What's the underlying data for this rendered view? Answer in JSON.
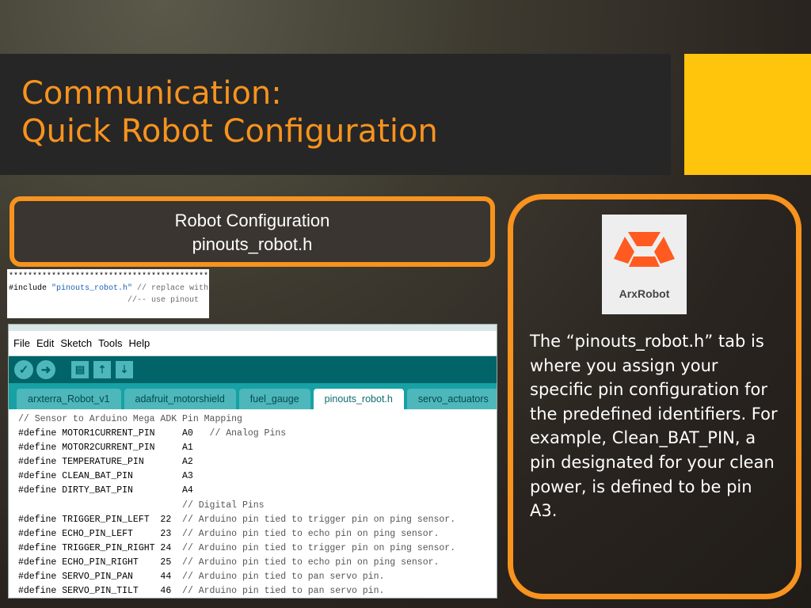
{
  "slide": {
    "title_line1": "Communication:",
    "title_line2": "Quick Robot Configuration"
  },
  "label_box": {
    "line1": "Robot Configuration",
    "line2": "pinouts_robot.h"
  },
  "snippet": {
    "line1": "********************************************",
    "include_kw": "#include ",
    "include_file": "\"pinouts_robot.h\"",
    "include_comment": " // replace with",
    "line3": "                         //-- use pinout"
  },
  "ide": {
    "menu": [
      "File",
      "Edit",
      "Sketch",
      "Tools",
      "Help"
    ],
    "toolbar_icons": [
      "verify-icon",
      "upload-icon",
      "new-icon",
      "open-icon",
      "save-icon"
    ],
    "tabs": [
      "arxterra_Robot_v1",
      "adafruit_motorshield",
      "fuel_gauge",
      "pinouts_robot.h",
      "servo_actuators"
    ],
    "active_tab": "pinouts_robot.h",
    "code_lines": [
      {
        "code": "// Sensor to Arduino Mega ADK Pin Mapping",
        "comment": ""
      },
      {
        "code": "#define MOTOR1CURRENT_PIN     A0   ",
        "comment": "// Analog Pins"
      },
      {
        "code": "#define MOTOR2CURRENT_PIN     A1",
        "comment": ""
      },
      {
        "code": "#define TEMPERATURE_PIN       A2",
        "comment": ""
      },
      {
        "code": "#define CLEAN_BAT_PIN         A3",
        "comment": ""
      },
      {
        "code": "#define DIRTY_BAT_PIN         A4",
        "comment": ""
      },
      {
        "code": "                              ",
        "comment": "// Digital Pins"
      },
      {
        "code": "#define TRIGGER_PIN_LEFT  22  ",
        "comment": "// Arduino pin tied to trigger pin on ping sensor."
      },
      {
        "code": "#define ECHO_PIN_LEFT     23  ",
        "comment": "// Arduino pin tied to echo pin on ping sensor."
      },
      {
        "code": "#define TRIGGER_PIN_RIGHT 24  ",
        "comment": "// Arduino pin tied to trigger pin on ping sensor."
      },
      {
        "code": "#define ECHO_PIN_RIGHT    25  ",
        "comment": "// Arduino pin tied to echo pin on ping sensor."
      },
      {
        "code": "#define SERVO_PIN_PAN     44  ",
        "comment": "// Arduino pin tied to pan servo pin."
      },
      {
        "code": "#define SERVO_PIN_TILT    46  ",
        "comment": "// Arduino pin tied to pan servo pin."
      }
    ]
  },
  "logo": {
    "text": "ArxRobot",
    "color": "#ff5a1f"
  },
  "info": {
    "text": "The “pinouts_robot.h” tab is where you assign your specific pin configuration for the predefined identifiers. For example, Clean_BAT_PIN, a pin designated for your clean power, is defined to be pin A3."
  },
  "colors": {
    "accent_orange": "#f7931e",
    "accent_yellow": "#ffc40c",
    "title_band": "#262626",
    "ide_teal": "#006468",
    "ide_tab_teal": "#17a1a5"
  }
}
